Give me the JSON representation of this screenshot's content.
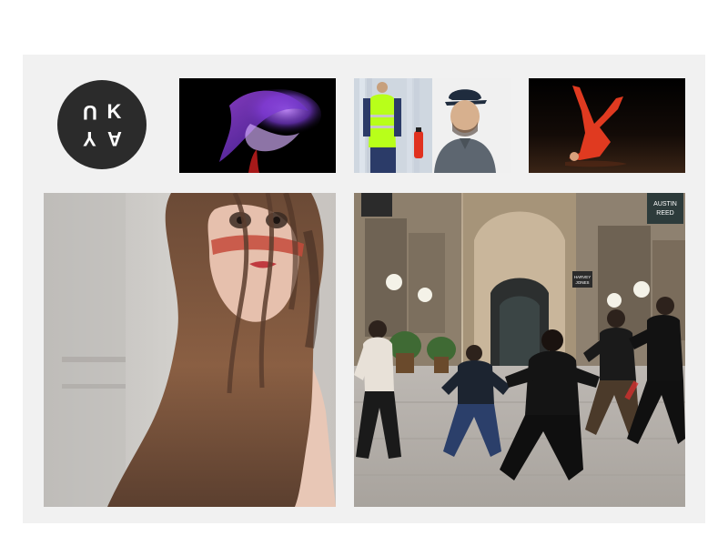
{
  "logo": {
    "letters": [
      "U",
      "K",
      "Y",
      "A"
    ],
    "background": "#2b2b2b",
    "foreground": "#ffffff"
  },
  "gallery": {
    "tiles": [
      {
        "id": "dance-motion-purple",
        "type": "photo"
      },
      {
        "id": "worker-and-man-portrait",
        "type": "photo"
      },
      {
        "id": "red-dancer-inverted",
        "type": "photo"
      },
      {
        "id": "long-hair-portrait",
        "type": "photo"
      },
      {
        "id": "street-dance-arcade",
        "type": "photo"
      }
    ]
  },
  "arcade_signs": {
    "sign_left_top": "",
    "sign_right_top": "AUSTIN REED",
    "sign_mid_1": "HARVEY JONES",
    "sign_mid_2": "",
    "sign_mid_3": ""
  },
  "colors": {
    "panel_bg": "#f1f1f1",
    "page_bg": "#ffffff"
  }
}
